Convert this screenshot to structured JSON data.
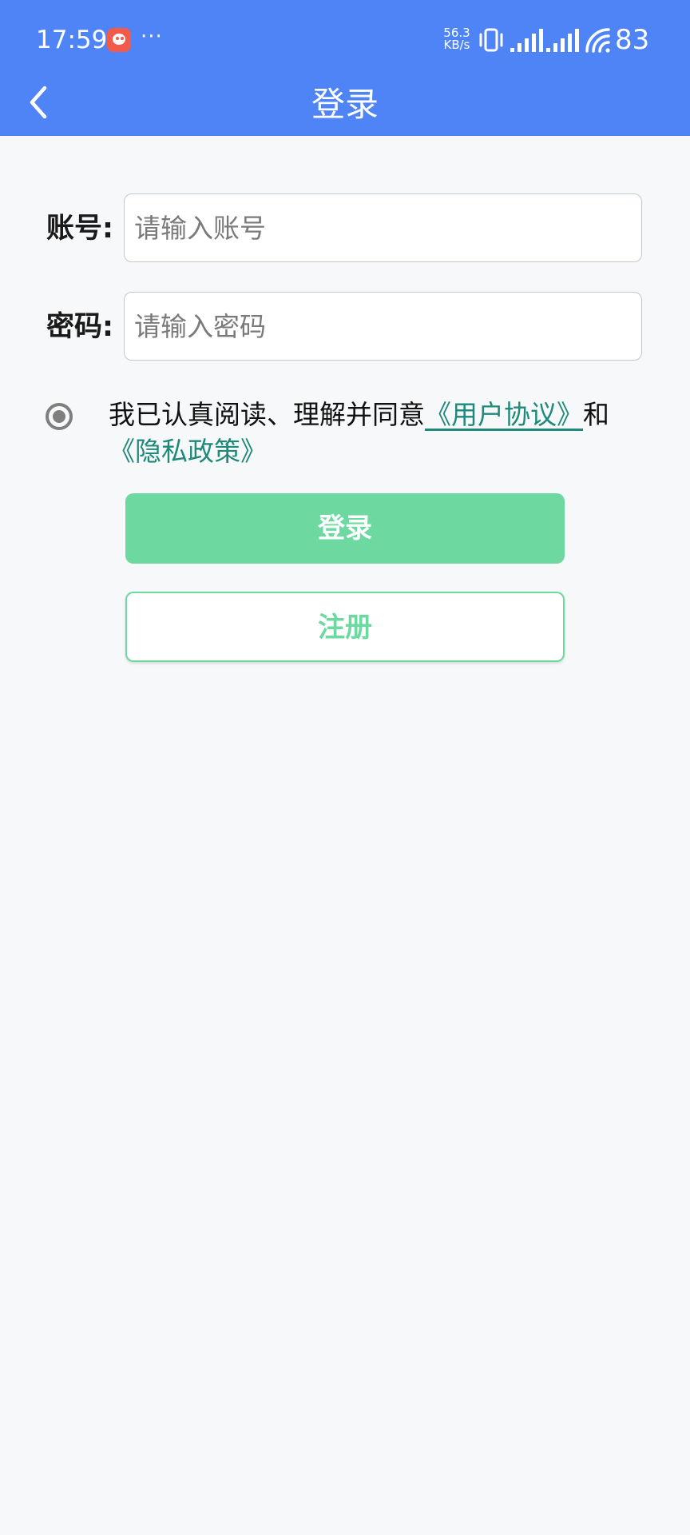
{
  "status_bar": {
    "time": "17:59",
    "more": "···",
    "net_speed_value": "56.3",
    "net_speed_unit": "KB/s",
    "battery": "83",
    "icons": [
      "app-notification-icon",
      "vibrate-icon",
      "signal-icon",
      "signal-icon",
      "wifi-icon"
    ]
  },
  "header": {
    "title": "登录",
    "back_icon": "chevron-left-icon",
    "background_color": "#4f84f7"
  },
  "form": {
    "account": {
      "label": "账号:",
      "placeholder": "请输入账号",
      "value": ""
    },
    "password": {
      "label": "密码:",
      "placeholder": "请输入密码",
      "value": ""
    }
  },
  "agreement": {
    "selected": true,
    "prefix": "我已认真阅读、理解并同意",
    "user_agreement_link": "《用户协议》",
    "conjunction": "和",
    "privacy_policy_link": "《隐私政策》",
    "link_color": "#1f8a7a"
  },
  "actions": {
    "login_label": "登录",
    "register_label": "注册",
    "accent_color": "#6dd9a0"
  }
}
